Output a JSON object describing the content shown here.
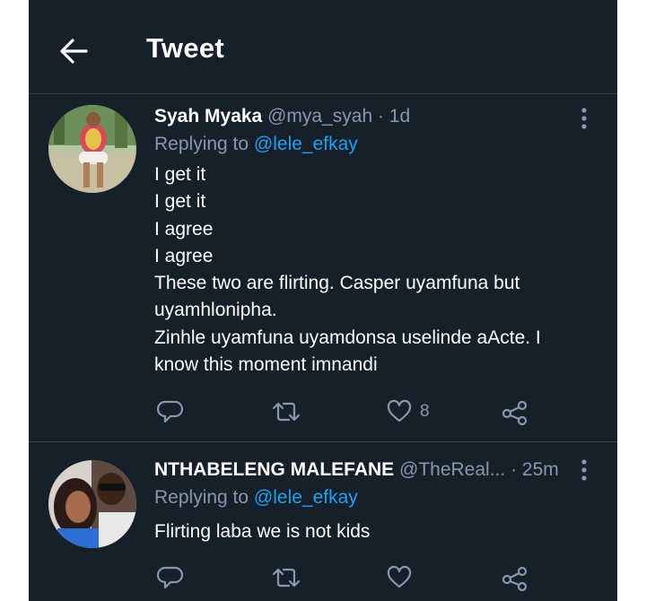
{
  "header": {
    "title": "Tweet",
    "back_icon": "arrow-left-icon"
  },
  "tweets": [
    {
      "display_name": "Syah Myaka",
      "handle": "@mya_syah",
      "separator": "·",
      "time": "1d",
      "replying_prefix": "Replying to",
      "replying_to": "@lele_efkay",
      "text_lines": [
        "I get it",
        "I get it",
        "I agree",
        "I agree",
        "These two are flirting. Casper uyamfuna but",
        "uyamhlonipha.",
        "Zinhle uyamfuna uyamdonsa uselinde aActe. I",
        "know this moment imnandi"
      ],
      "reply_count": "",
      "retweet_count": "",
      "like_count": "8"
    },
    {
      "display_name": "NTHABELENG MALEFANE",
      "handle": "@TheReal...",
      "separator": "·",
      "time": "25m",
      "replying_prefix": "Replying to",
      "replying_to": "@lele_efkay",
      "text_lines": [
        "Flirting laba we is not kids"
      ],
      "reply_count": "",
      "retweet_count": "",
      "like_count": ""
    }
  ],
  "colors": {
    "background": "#15202b",
    "secondary_text": "#8899a6",
    "link": "#1da1f2",
    "divider": "#38444d"
  }
}
